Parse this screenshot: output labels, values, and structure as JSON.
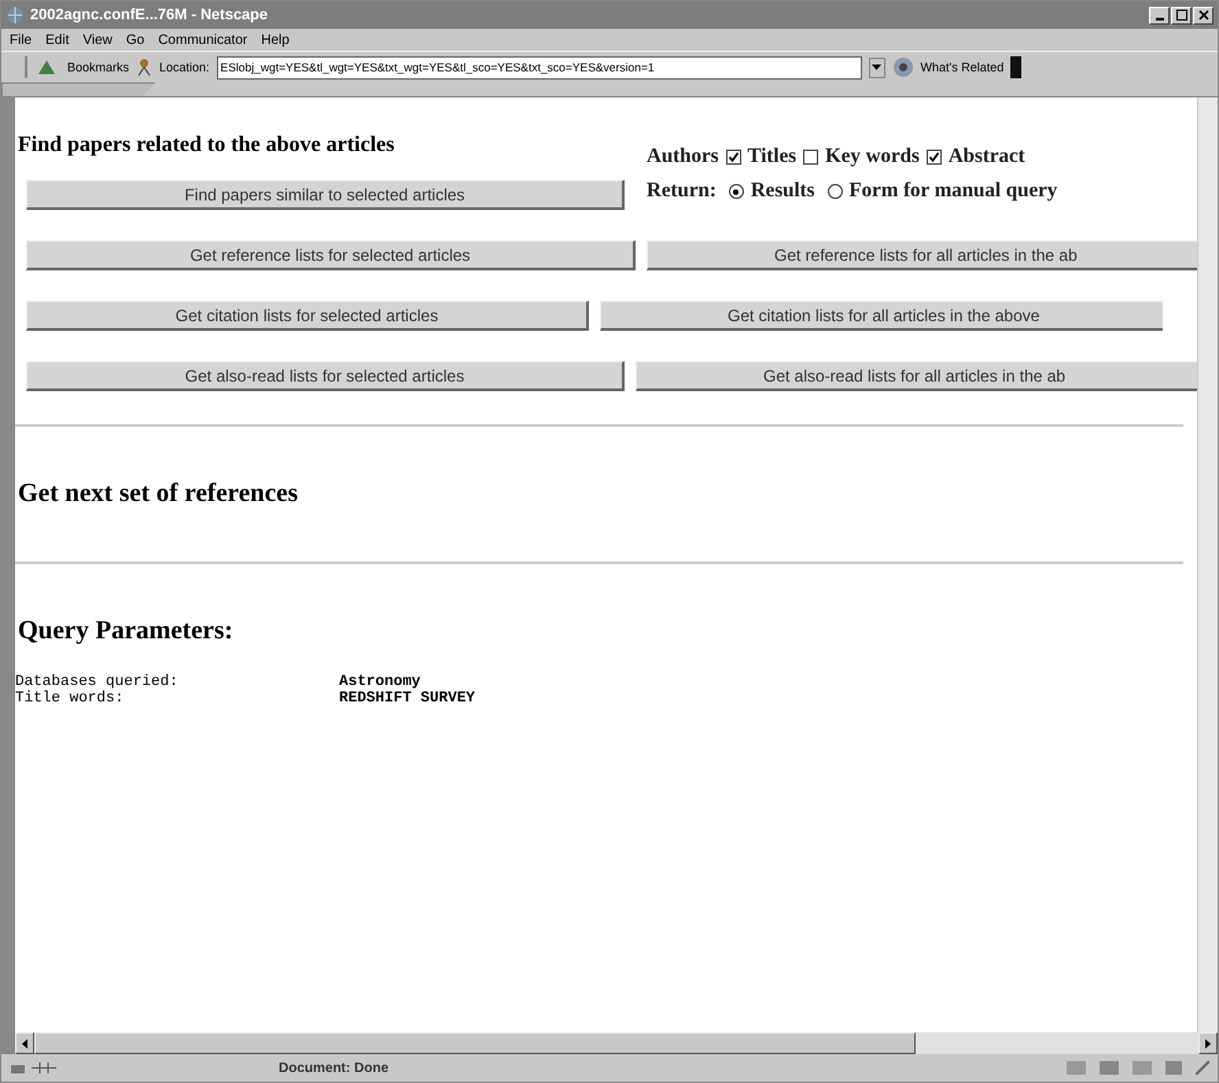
{
  "window": {
    "title": "2002agnc.confE...76M - Netscape"
  },
  "menu": [
    "File",
    "Edit",
    "View",
    "Go",
    "Communicator",
    "Help"
  ],
  "toolbar": {
    "bookmarks": "Bookmarks",
    "location_label": "Location:",
    "url": "ESlobj_wgt=YES&tl_wgt=YES&txt_wgt=YES&tl_sco=YES&txt_sco=YES&version=1",
    "related": "What's Related"
  },
  "page": {
    "heading": "Find papers related to the above articles",
    "weights": {
      "lead": "Authors",
      "options": [
        {
          "label": "Titles",
          "checked": true
        },
        {
          "label": "Key words",
          "checked": false
        },
        {
          "label": "Abstract",
          "checked": true
        }
      ]
    },
    "return": {
      "label": "Return:",
      "options": [
        {
          "label": "Results",
          "selected": true
        },
        {
          "label": "Form for manual query",
          "selected": false
        }
      ]
    },
    "button_rows": [
      {
        "left": "Find papers similar to selected articles"
      },
      {
        "left": "Get reference lists for selected articles",
        "right": "Get reference lists for all articles in the ab"
      },
      {
        "left": "Get citation lists for selected articles",
        "right": "Get citation lists for all articles in the above"
      },
      {
        "left": "Get also-read lists for selected articles",
        "right": "Get also-read lists for all articles in the ab"
      }
    ],
    "next_heading": "Get next set of references",
    "params_heading": "Query Parameters:",
    "params": [
      {
        "name": "Databases queried:",
        "value": "Astronomy"
      },
      {
        "name": "Title words:",
        "value": "REDSHIFT SURVEY"
      }
    ]
  },
  "status_bar": {
    "text": "Document: Done"
  }
}
